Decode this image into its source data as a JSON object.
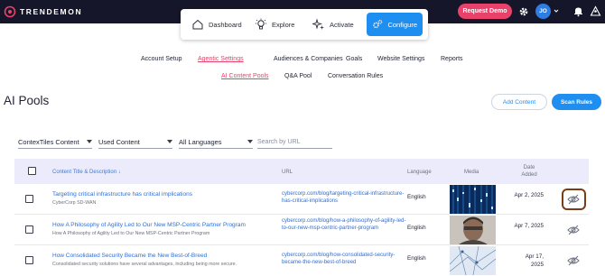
{
  "brand": {
    "name": "TRENDEMON",
    "mark_color": "#e8426a"
  },
  "header": {
    "request_demo_label": "Request Demo",
    "avatar_initials": "JO",
    "settings_icon": "gear-icon",
    "notifications_icon": "bell-icon",
    "user_icon": "user-icon"
  },
  "main_nav": [
    {
      "label": "Dashboard",
      "icon": "home-icon"
    },
    {
      "label": "Explore",
      "icon": "lightbulb-icon"
    },
    {
      "label": "Activate",
      "icon": "sparkle-icon"
    },
    {
      "label": "Configure",
      "icon": "gears-icon",
      "active": true
    }
  ],
  "sub_nav": [
    {
      "label": "Account Setup"
    },
    {
      "label": "Agentic Settings",
      "active": true
    },
    {
      "label": "Audiences & Companies"
    },
    {
      "label": "Goals"
    },
    {
      "label": "Website Settings"
    },
    {
      "label": "Reports"
    }
  ],
  "sub_nav2": [
    {
      "label": "AI Content Pools",
      "active": true
    },
    {
      "label": "Q&A Pool"
    },
    {
      "label": "Conversation Rules"
    }
  ],
  "page": {
    "title": "AI Pools",
    "add_content_label": "Add Content",
    "scan_rules_label": "Scan Rules"
  },
  "filters": {
    "content_type": "ContexTiles Content",
    "content_status": "Used Content",
    "language": "All Languages",
    "search_placeholder": "Search by URL"
  },
  "table": {
    "columns": {
      "title": "Content Title & Description ↓",
      "url": "URL",
      "language": "Language",
      "media": "Media",
      "date_added": "Date Added"
    },
    "rows": [
      {
        "title": "Targeting critical infrastructure has critical implications",
        "description": "CyberCorp SD-WAN",
        "url": "cybercorp.com/blog/targeting-critical-infrastructure-has-critical-implications",
        "language": "English",
        "date": "Apr 2, 2025"
      },
      {
        "title": "How A Philosophy of Agility Led to Our New MSP-Centric Partner Program",
        "description": "How A Philosophy of Agility Led to Our New MSP-Centric Partner Program",
        "url": "cybercorp.com/blog/how-a-philosophy-of-agility-led-to-our-new-msp-centric-partner-program",
        "language": "English",
        "date": "Apr 7, 2025"
      },
      {
        "title": "How Consolidated Security Became the New Best-of-Breed",
        "description": "Consolidated security solutions have several advantages, including being more secure.",
        "url": "cybercorp.com/blog/how-consolidated-security-became-the-new-best-of-breed",
        "language": "English",
        "date": "Apr 17, 2025"
      }
    ]
  },
  "colors": {
    "accent": "#1e8ef0",
    "brand_pink": "#e8426a",
    "topbar": "#16162a",
    "header_row": "#ecebfb"
  }
}
